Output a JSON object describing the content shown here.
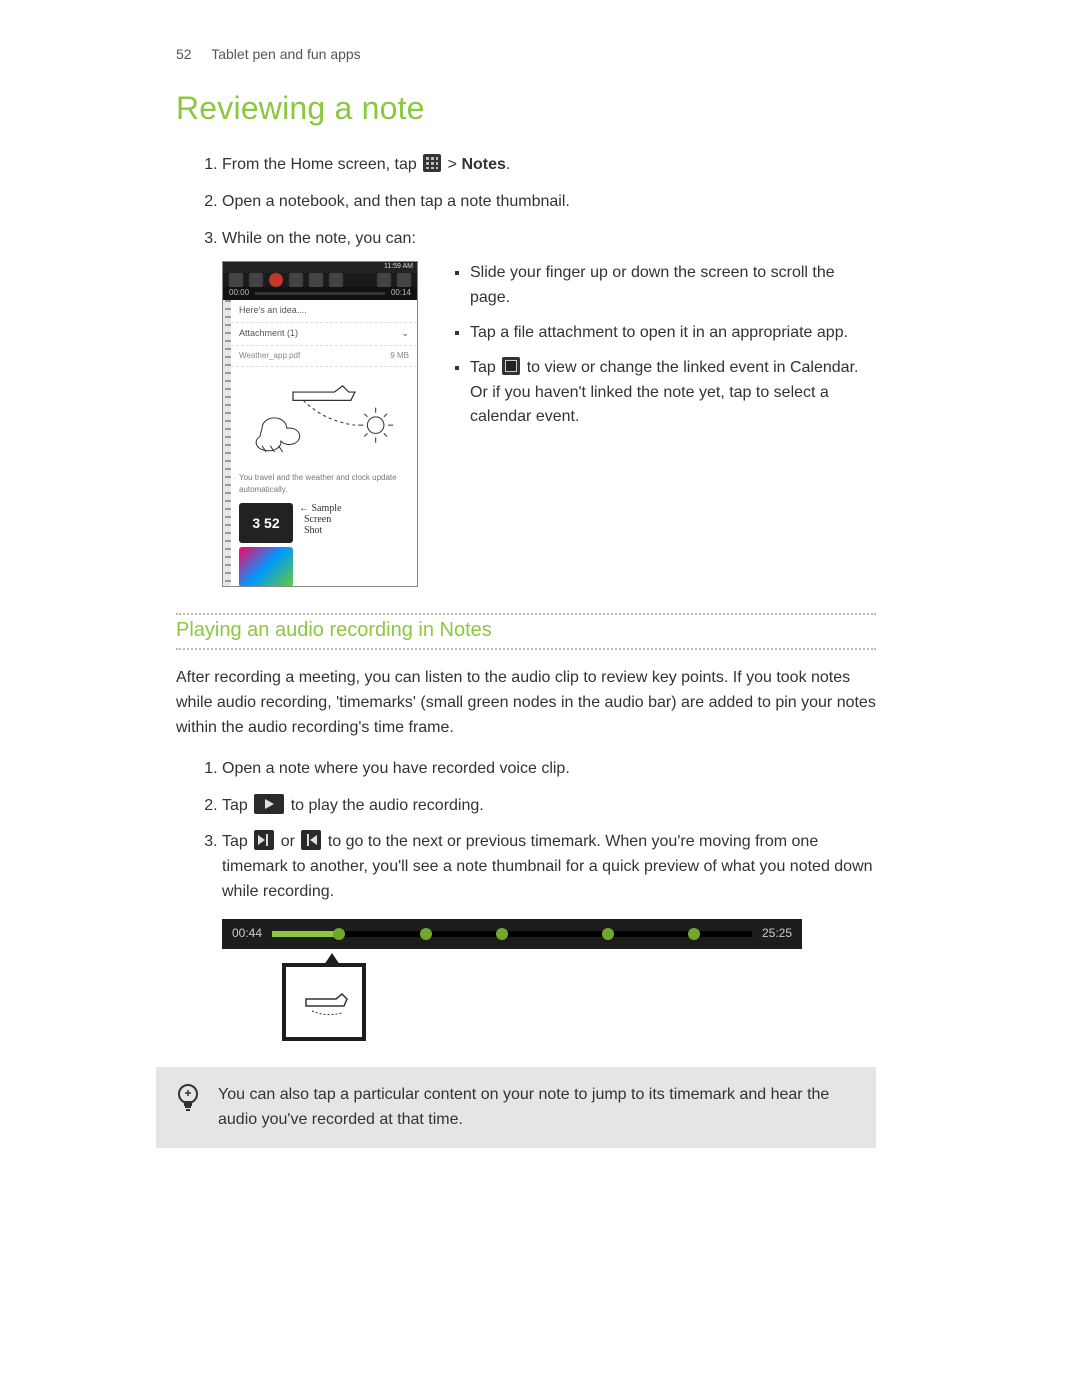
{
  "header": {
    "page_number": "52",
    "section": "Tablet pen and fun apps"
  },
  "title": "Reviewing a note",
  "steps_a": {
    "s1_a": "From the Home screen, tap ",
    "s1_b": " > ",
    "s1_notes": "Notes",
    "s1_c": ".",
    "s2": "Open a notebook, and then tap a note thumbnail.",
    "s3": "While on the note, you can:"
  },
  "phone": {
    "status_time": "11:59 AM",
    "prog_left": "00:00",
    "prog_right": "00:14",
    "idea": "Here's an idea....",
    "attach_label": "Attachment (1)",
    "attach_file": "Weather_app.pdf",
    "attach_size": "9 MB",
    "caption": "You travel and the weather and clock update automatically.",
    "clock": "3 52",
    "hand1": "Sample",
    "hand2": "Screen",
    "hand3": "Shot"
  },
  "bullets": {
    "b1": "Slide your finger up or down the screen to scroll the page.",
    "b2": "Tap a file attachment to open it in an appropriate app.",
    "b3_a": "Tap ",
    "b3_b": " to view or change the linked event in Calendar. Or if you haven't linked the note yet, tap to select a calendar event."
  },
  "section2": {
    "heading": "Playing an audio recording in Notes",
    "para": "After recording a meeting, you can listen to the audio clip to review key points. If you took notes while audio recording, 'timemarks' (small green nodes in the audio bar) are added to pin your notes within the audio recording's time frame.",
    "s1": "Open a note where you have recorded voice clip.",
    "s2_a": "Tap ",
    "s2_b": " to play the audio recording.",
    "s3_a": "Tap ",
    "s3_b": " or ",
    "s3_c": " to go to the next or previous timemark. When you're moving from one timemark to another, you'll see a note thumbnail for a quick preview of what you noted down while recording."
  },
  "timeline": {
    "left": "00:44",
    "right": "25:25"
  },
  "tip": "You can also tap a particular content on your note to jump to its timemark and hear the audio you've recorded at that time."
}
